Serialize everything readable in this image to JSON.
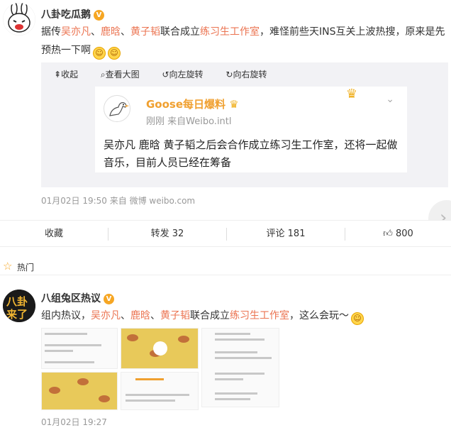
{
  "post1": {
    "author": "八卦吃瓜鹅",
    "badge": "V",
    "text_parts": [
      "据传",
      "吴亦凡",
      "、",
      "鹿晗",
      "、",
      "黄子韬",
      "联合成立",
      "练习生工作室",
      "，难怪前些天INS互关上波热搜，原来是先预热一下啊"
    ],
    "media_tools": [
      "收起",
      "查看大图",
      "向左旋转",
      "向右旋转"
    ],
    "quote": {
      "name": "Goose每日爆料",
      "time": "刚刚  来自Weibo.intl",
      "text": "吴亦凡 鹿晗 黄子韬之后会合作成立练习生工作室，还将一起做音乐，目前人员已经在筹备"
    },
    "meta": "01月02日 19:50 来自 微博 weibo.com",
    "actions": {
      "favorite": "收藏",
      "repost": "转发 32",
      "comment": "评论 181",
      "like": "800"
    }
  },
  "hot_label": "热门",
  "post2": {
    "author": "八组兔区热议",
    "badge": "V",
    "text_parts": [
      "组内热议，",
      "吴亦凡",
      "、",
      "鹿晗",
      "、",
      "黄子韬",
      "联合成立",
      "练习生工作室",
      "，这么会玩～"
    ],
    "meta": "01月02日 19:27"
  },
  "colors": {
    "highlight": "#eb7350",
    "badge": "#f6a623",
    "quote_name": "#f0a030"
  }
}
